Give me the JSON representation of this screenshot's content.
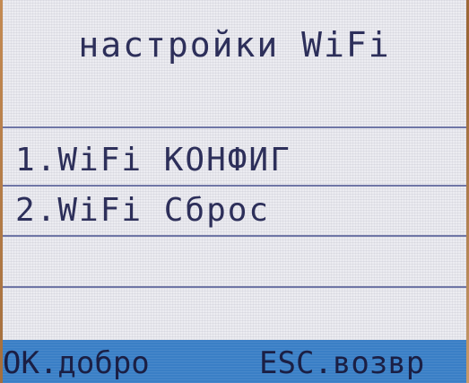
{
  "screen": {
    "title": "настройки WiFi"
  },
  "menu": {
    "items": [
      {
        "label": "1.WiFi КОНФИГ"
      },
      {
        "label": "2.WiFi Сброс"
      }
    ]
  },
  "footer": {
    "ok_label": "OK.добро",
    "esc_label": "ESC.возвр",
    "background_color": "#3a7fc6"
  },
  "colors": {
    "screen_background": "#ececf1",
    "text": "#2d2f5a",
    "separator": "#6f76a6"
  }
}
